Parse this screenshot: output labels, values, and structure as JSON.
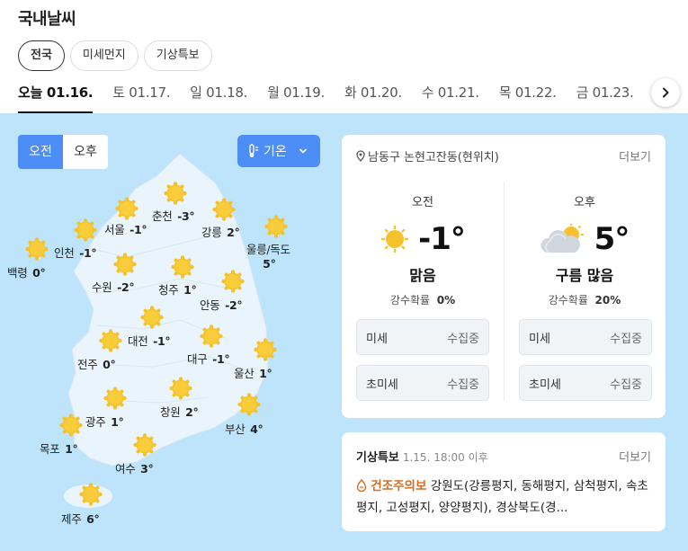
{
  "header": {
    "title": "국내날씨"
  },
  "chips": [
    "전국",
    "미세먼지",
    "기상특보"
  ],
  "dates": [
    "오늘 01.16.",
    "토 01.17.",
    "일 01.18.",
    "월 01.19.",
    "화 01.20.",
    "수 01.21.",
    "목 01.22.",
    "금 01.23."
  ],
  "map": {
    "ampm": [
      "오전",
      "오후"
    ],
    "temp_selector": "기온",
    "cities": [
      {
        "name": "서울",
        "temp": "-1°"
      },
      {
        "name": "춘천",
        "temp": "-3°"
      },
      {
        "name": "강릉",
        "temp": "2°"
      },
      {
        "name": "울릉/독도",
        "temp": "5°"
      },
      {
        "name": "인천",
        "temp": "-1°"
      },
      {
        "name": "백령",
        "temp": "0°"
      },
      {
        "name": "수원",
        "temp": "-2°"
      },
      {
        "name": "청주",
        "temp": "1°"
      },
      {
        "name": "안동",
        "temp": "-2°"
      },
      {
        "name": "대전",
        "temp": "-1°"
      },
      {
        "name": "대구",
        "temp": "-1°"
      },
      {
        "name": "전주",
        "temp": "0°"
      },
      {
        "name": "울산",
        "temp": "1°"
      },
      {
        "name": "광주",
        "temp": "1°"
      },
      {
        "name": "창원",
        "temp": "2°"
      },
      {
        "name": "부산",
        "temp": "4°"
      },
      {
        "name": "목포",
        "temp": "1°"
      },
      {
        "name": "여수",
        "temp": "3°"
      },
      {
        "name": "제주",
        "temp": "6°"
      }
    ]
  },
  "panel": {
    "location": "남동구 논현고잔동(현위치)",
    "more": "더보기",
    "am": {
      "label": "오전",
      "temp": "-1°",
      "condition": "맑음",
      "rain_label": "강수확률",
      "rain_value": "0%",
      "icon": "sun-icon"
    },
    "pm": {
      "label": "오후",
      "temp": "5°",
      "condition": "구름 많음",
      "rain_label": "강수확률",
      "rain_value": "20%",
      "icon": "cloud-sun-icon"
    },
    "dust": {
      "fine_label": "미세",
      "ultrafine_label": "초미세",
      "status": "수집중"
    }
  },
  "alert": {
    "title": "기상특보",
    "time": "1.15. 18:00 이후",
    "more": "더보기",
    "kind": "건조주의보",
    "text": "강원도(강릉평지, 동해평지, 삼척평지, 속초평지, 고성평지, 양양평지), 경상북도(경..."
  },
  "colors": {
    "accent": "#4c8df6",
    "sky": "#bde4fb",
    "land": "#e9f4fc",
    "sun": "#f6c22c",
    "warning": "#d96c1f"
  }
}
